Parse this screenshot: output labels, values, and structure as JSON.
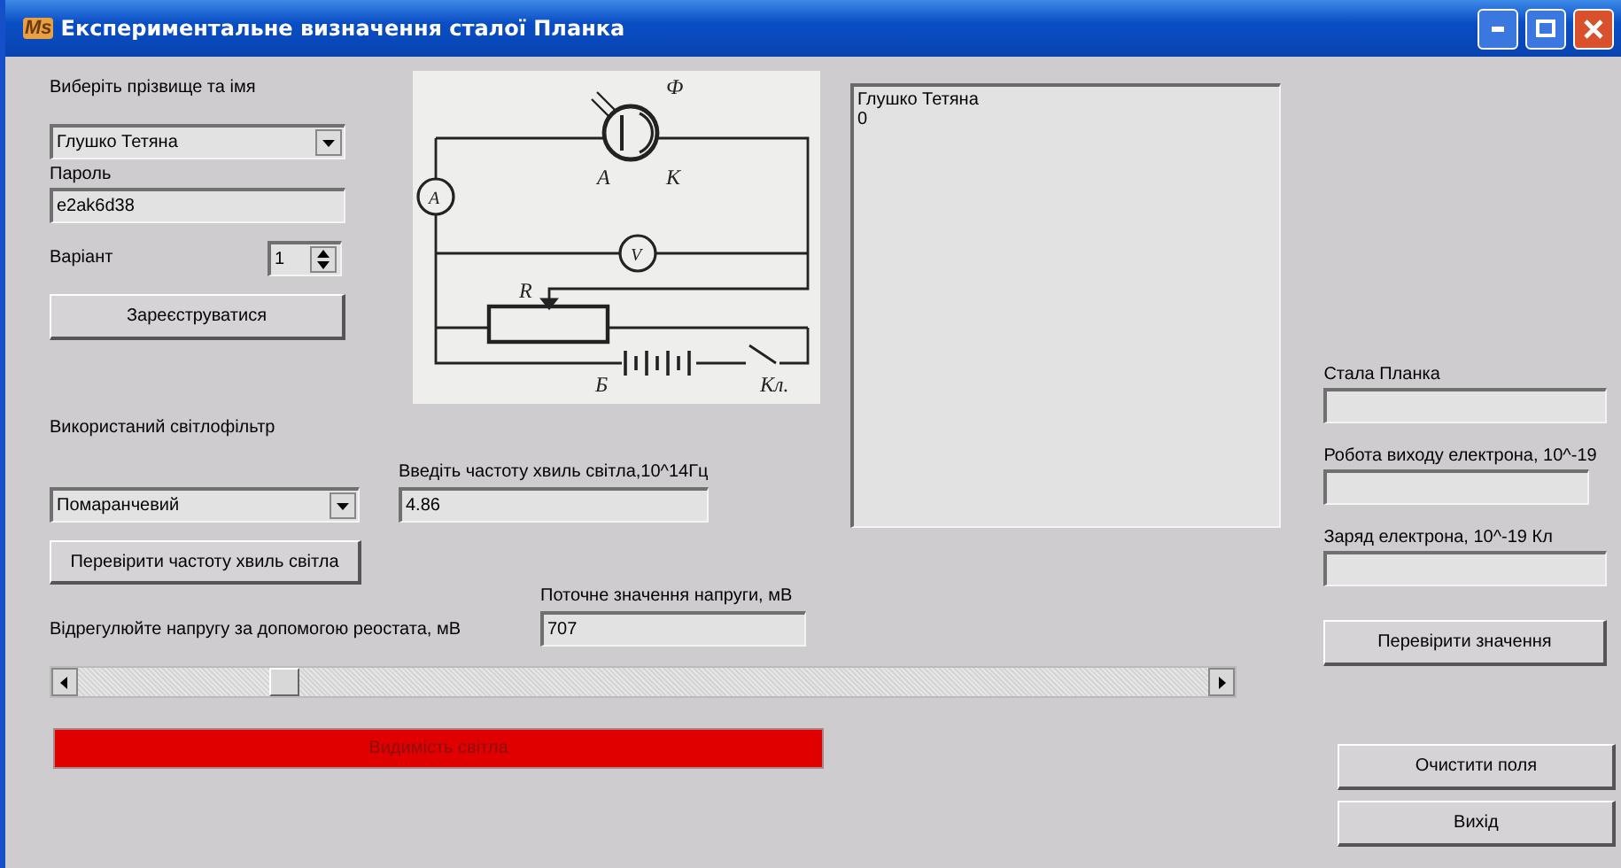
{
  "window": {
    "icon_text": "Ms",
    "title": "Експериментальне визначення сталої Планка"
  },
  "student": {
    "label": "Виберіть прізвище та імя",
    "value": "Глушко Тетяна"
  },
  "password": {
    "label": "Пароль",
    "value": "e2ak6d38"
  },
  "variant": {
    "label": "Варіант",
    "value": "1"
  },
  "register_button": "Зареєструватися",
  "diagram": {
    "photocell": "Ф",
    "anode": "А",
    "cathode": "К",
    "ammeter": "A",
    "voltmeter": "V",
    "rheostat": "R",
    "battery": "Б",
    "key": "Кл."
  },
  "log": {
    "lines": [
      "Глушко Тетяна",
      "0"
    ]
  },
  "filter": {
    "label": "Використаний світлофільтр",
    "value": "Помаранчевий"
  },
  "frequency": {
    "label": "Введіть частоту хвиль світла,10^14Гц",
    "value": "4.86"
  },
  "check_frequency_button": "Перевірити частоту хвиль світла",
  "voltage_hint": "Відрегулюйте напругу за допомогою реостата, мВ",
  "voltage": {
    "label": "Поточне значення напруги, мВ",
    "value": "707"
  },
  "visibility_bar": "Видимість світла",
  "results": [
    {
      "label": "Стала Планка"
    },
    {
      "label": "Робота виходу електрона, 10^-19"
    },
    {
      "label": "Заряд електрона, 10^-19 Кл"
    }
  ],
  "check_values_button": "Перевірити значення",
  "clear_button": "Очистити поля",
  "exit_button": "Вихід"
}
